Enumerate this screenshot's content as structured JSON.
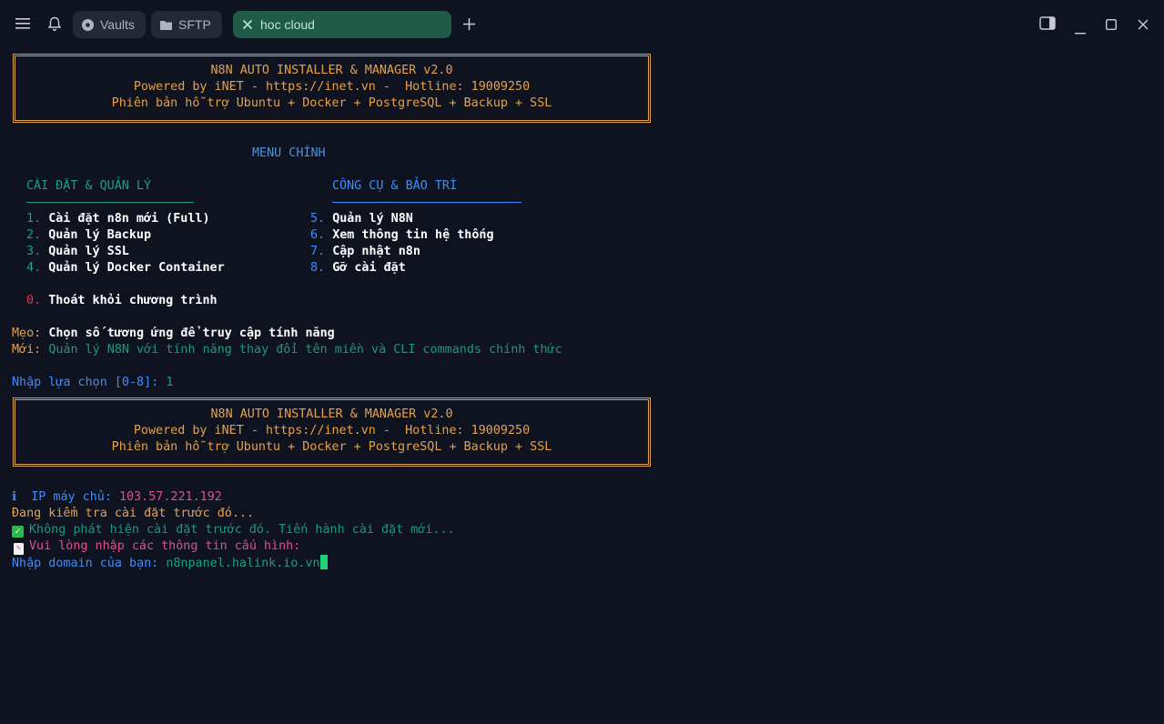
{
  "topbar": {
    "tabs": [
      {
        "label": "Vaults",
        "icon": "vault-icon"
      },
      {
        "label": "SFTP",
        "icon": "folder-icon"
      },
      {
        "label": "hoc cloud",
        "icon": "close-icon",
        "active": true
      }
    ]
  },
  "banner": {
    "line1": "N8N AUTO INSTALLER & MANAGER v2.0",
    "line2": "Powered by iNET - https://inet.vn -  Hotline: 19009250",
    "line3": "Phiên bản hỗ trợ Ubuntu + Docker + PostgreSQL + Backup + SSL"
  },
  "menu": {
    "title": "MENU CHÍNH",
    "left_header": "CÀI ĐẶT & QUẢN LÝ",
    "right_header": "CÔNG CỤ & BẢO TRÌ",
    "left_items": [
      {
        "num": "1.",
        "label": "Cài đặt n8n mới (Full)"
      },
      {
        "num": "2.",
        "label": "Quản lý Backup"
      },
      {
        "num": "3.",
        "label": "Quản lý SSL"
      },
      {
        "num": "4.",
        "label": "Quản lý Docker Container"
      }
    ],
    "right_items": [
      {
        "num": "5.",
        "label": "Quản lý N8N"
      },
      {
        "num": "6.",
        "label": "Xem thông tin hệ thống"
      },
      {
        "num": "7.",
        "label": "Cập nhật n8n"
      },
      {
        "num": "8.",
        "label": "Gỡ cài đặt"
      }
    ],
    "exit": {
      "num": "0.",
      "label": "Thoát khỏi chương trình"
    }
  },
  "tips": {
    "tip_label": "Mẹo:",
    "tip_text": "Chọn số tương ứng để truy cập tính năng",
    "new_label": "Mới:",
    "new_text": "Quản lý N8N với tính năng thay đổi tên miền và CLI commands chính thức"
  },
  "prompt": {
    "label": "Nhập lựa chọn [0-8]:",
    "value": "1"
  },
  "output": {
    "info_icon": "ℹ",
    "ip_label": "IP máy chủ:",
    "ip_value": "103.57.221.192",
    "checking": "Đang kiểm tra cài đặt trước đó...",
    "not_found": "Không phát hiện cài đặt trước đó. Tiến hành cài đặt mới...",
    "enter_info": "Vui lòng nhập các thông tin cấu hình:",
    "domain_label": "Nhập domain của bạn:",
    "domain_value": "n8npanel.halink.io.vn"
  },
  "colors": {
    "background": "#0f1320",
    "accent_orange": "#e5a14c",
    "accent_blue": "#3f8dfc",
    "accent_teal": "#1f9e82",
    "active_tab": "#1f5b46"
  }
}
